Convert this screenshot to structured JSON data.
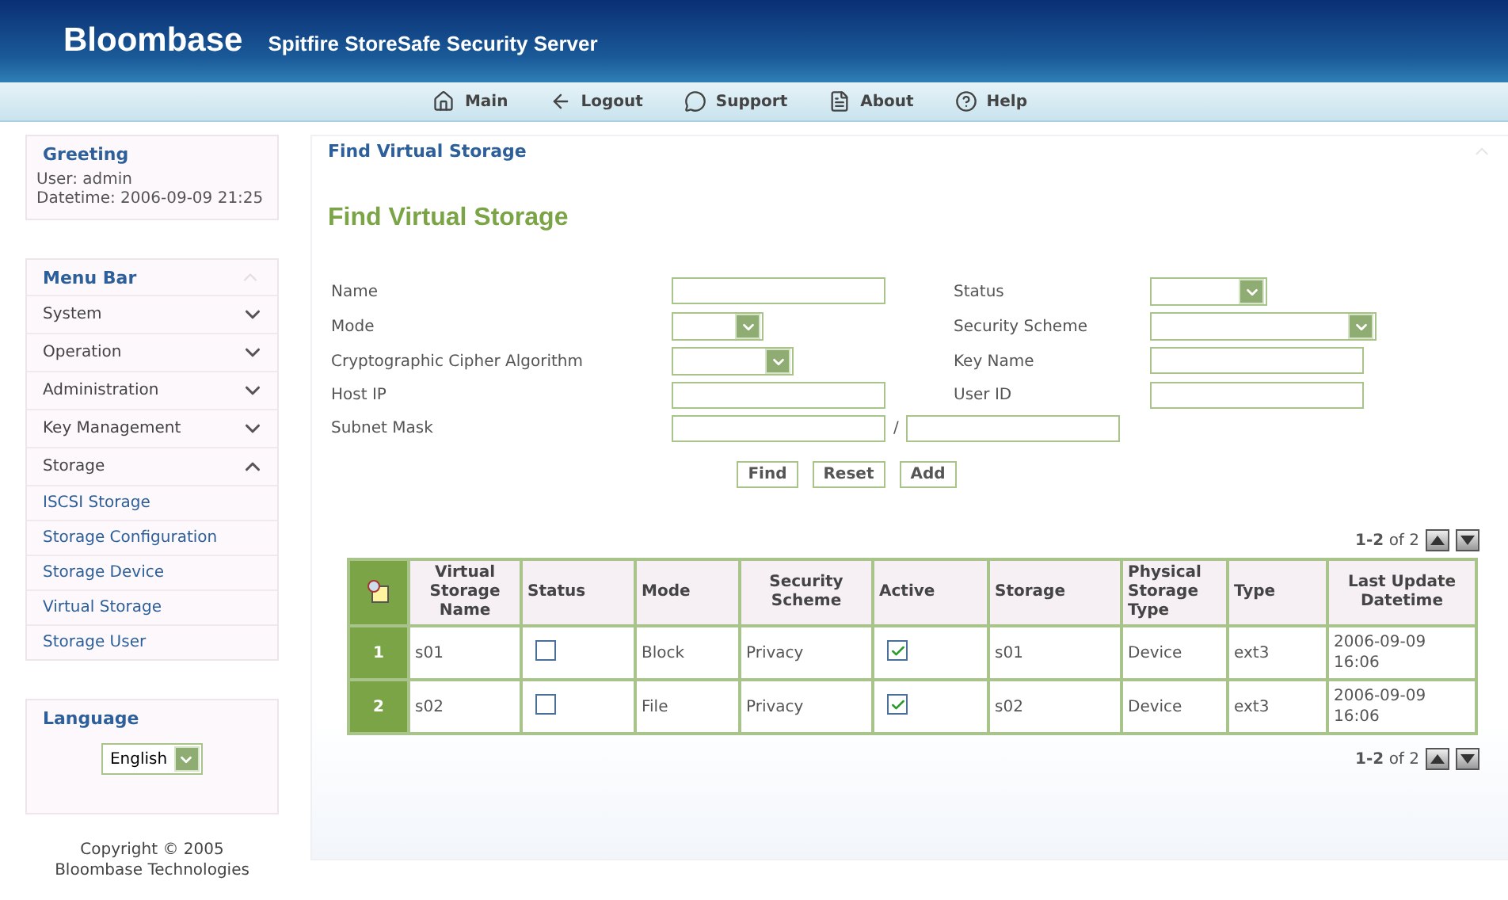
{
  "header": {
    "brand": "Bloombase",
    "product": "Spitfire StoreSafe Security Server"
  },
  "nav": [
    {
      "label": "Main",
      "kind": "home"
    },
    {
      "label": "Logout",
      "kind": "back"
    },
    {
      "label": "Support",
      "kind": "chat"
    },
    {
      "label": "About",
      "kind": "doc"
    },
    {
      "label": "Help",
      "kind": "help"
    }
  ],
  "greeting": {
    "title": "Greeting",
    "lines": [
      "User: admin",
      "Datetime: 2006-09-09 21:25"
    ]
  },
  "menu": {
    "title": "Menu Bar",
    "items": [
      {
        "label": "System",
        "expanded": false
      },
      {
        "label": "Operation",
        "expanded": false
      },
      {
        "label": "Administration",
        "expanded": false
      },
      {
        "label": "Key Management",
        "expanded": false
      },
      {
        "label": "Storage",
        "expanded": true,
        "children": [
          {
            "label": "ISCSI Storage"
          },
          {
            "label": "Storage Configuration"
          },
          {
            "label": "Storage Device"
          },
          {
            "label": "Virtual Storage"
          },
          {
            "label": "Storage User"
          }
        ]
      }
    ]
  },
  "language": {
    "title": "Language",
    "value": "English"
  },
  "copyright": [
    "Copyright © 2005",
    "Bloombase Technologies"
  ],
  "panel": {
    "title": "Find Virtual Storage",
    "heading": "Find Virtual Storage"
  },
  "fields": [
    {
      "label": "Name",
      "kind": "text"
    },
    {
      "label": "Status",
      "kind": "select"
    },
    {
      "label": "Mode",
      "kind": "select"
    },
    {
      "label": "Security Scheme",
      "kind": "wide-select"
    },
    {
      "label": "Cryptographic Cipher Algorithm",
      "kind": "select"
    },
    {
      "label": "Key Name",
      "kind": "text"
    },
    {
      "label": "Host IP",
      "kind": "text"
    },
    {
      "label": "User ID",
      "kind": "text"
    },
    {
      "label": "Subnet Mask",
      "kind": "range",
      "separator": "/"
    }
  ],
  "buttons": [
    "Find",
    "Reset",
    "Add"
  ],
  "pagination": [
    {
      "range": "1-2",
      "total": "of 2"
    },
    {
      "range": "1-2",
      "total": "of 2"
    }
  ],
  "table": {
    "columns": [
      "Virtual Storage Name",
      "Status",
      "Mode",
      "Security Scheme",
      "Active",
      "Storage",
      "Physical Storage Type",
      "Type",
      "Last Update Datetime"
    ],
    "rows": [
      {
        "index": "1",
        "name": "s01",
        "status": false,
        "mode": "Block",
        "scheme": "Privacy",
        "active": true,
        "storage": "s01",
        "physical": "Device",
        "type": "ext3",
        "datetime": "2006-09-09 16:06"
      },
      {
        "index": "2",
        "name": "s02",
        "status": false,
        "mode": "File",
        "scheme": "Privacy",
        "active": true,
        "storage": "s02",
        "physical": "Device",
        "type": "ext3",
        "datetime": "2006-09-09 16:06"
      }
    ]
  }
}
